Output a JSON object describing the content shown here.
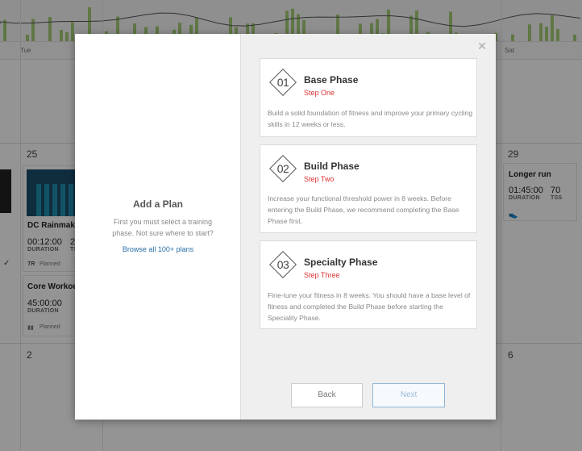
{
  "calendar": {
    "day_names": [
      "Tue",
      "Sat"
    ],
    "dates": [
      "25",
      "29",
      "2",
      "6"
    ],
    "cards": [
      {
        "title": "DC Rainmake",
        "value": "00:12:00",
        "value2": "2",
        "cap": "DURATION",
        "cap2": "TSS",
        "foot": "Planned",
        "logo": "TR"
      },
      {
        "title": "Core Workou",
        "value": "45:00:00",
        "cap": "DURATION",
        "foot": "Planned"
      },
      {
        "title": "Longer run",
        "value": "01:45:00",
        "value2": "70",
        "cap": "DURATION",
        "cap2": "TSS"
      }
    ]
  },
  "modal": {
    "left": {
      "title": "Add a Plan",
      "description": "First you must select a training phase. Not sure where to start?",
      "link": "Browse all 100+ plans"
    },
    "close_icon": "close-icon",
    "phases": [
      {
        "num": "01",
        "name": "Base Phase",
        "step": "Step One",
        "desc": "Build a solid foundation of fitness and improve your primary cycling skills in 12 weeks or less."
      },
      {
        "num": "02",
        "name": "Build Phase",
        "step": "Step Two",
        "desc": "Increase your functional threshold power in 8 weeks. Before entering the Build Phase, we recommend completing the Base Phase first."
      },
      {
        "num": "03",
        "name": "Specialty Phase",
        "step": "Step Three",
        "desc": "Fine-tune your fitness in 8 weeks. You should have a base level of fitness and completed the Build Phase before starting the Speciality Phase."
      }
    ],
    "buttons": {
      "back": "Back",
      "next": "Next"
    }
  },
  "colors": {
    "accent": "#2a6fa8",
    "step_red": "#dd3333",
    "chart_green": "#8bbf4d"
  }
}
